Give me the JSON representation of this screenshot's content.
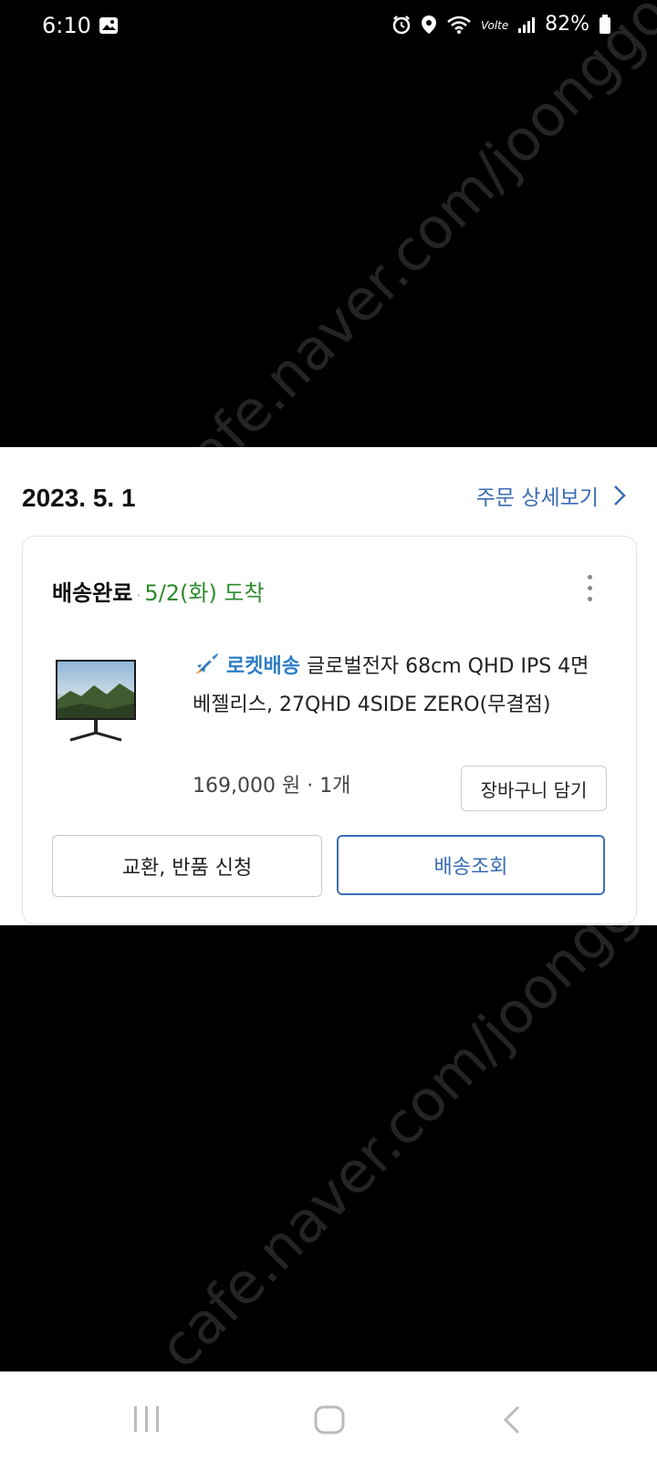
{
  "status_bar": {
    "time": "6:10",
    "battery": "82%"
  },
  "watermark": "cafe.naver.com/joonggonara",
  "order": {
    "date": "2023. 5. 1",
    "detail_link": "주문 상세보기",
    "status": "배송완료",
    "separator": "·",
    "arrival": "5/2(화) 도착",
    "product": {
      "rocket_label": "로켓배송",
      "name": "글로벌전자 68cm QHD IPS 4면 베젤리스, 27QHD 4SIDE ZERO(무결점)",
      "price": "169,000 원 · 1개"
    },
    "cart_button": "장바구니 담기",
    "return_button": "교환, 반품 신청",
    "track_button": "배송조회"
  },
  "colors": {
    "accent": "#3a6db5",
    "arrival": "#2e8a2e",
    "rocket": "#2f7ec4"
  }
}
